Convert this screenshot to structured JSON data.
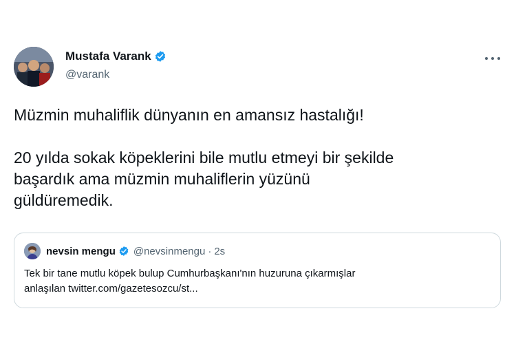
{
  "tweet": {
    "author": {
      "display_name": "Mustafa Varank",
      "handle": "@varank",
      "verified": true
    },
    "body": {
      "line1": "Müzmin muhaliflik dünyanın en amansız hastalığı!",
      "line2": "20 yılda sokak köpeklerini bile mutlu etmeyi bir şekilde",
      "line3": "başardık ama müzmin muhaliflerin yüzünü",
      "line4": "güldüremedik."
    },
    "quoted": {
      "display_name": "nevsin mengu",
      "handle": "@nevsinmengu",
      "separator": "·",
      "time": "2s",
      "verified": true,
      "line1": "Tek bir tane mutlu köpek bulup Cumhurbaşkanı'nın huzuruna çıkarmışlar",
      "line2": "anlaşılan twitter.com/gazetesozcu/st..."
    }
  },
  "icons": {
    "verified": "verified-badge-icon",
    "more": "more-options-icon"
  },
  "colors": {
    "verified": "#1d9bf0",
    "text": "#0f1419",
    "secondary": "#536471",
    "border": "#cfd9de"
  }
}
